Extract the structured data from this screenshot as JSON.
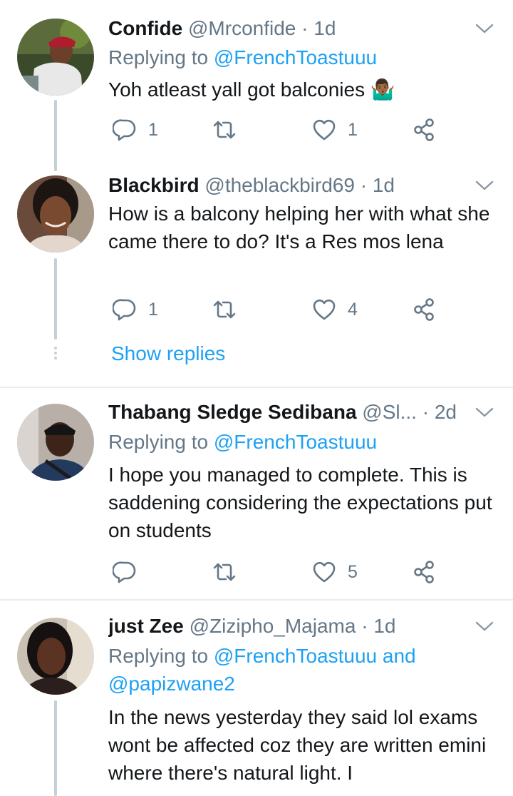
{
  "tweets": [
    {
      "name": "Confide",
      "handle": "@Mrconfide",
      "dot": "·",
      "time": "1d",
      "replying_prefix": "Replying to",
      "replying_to": "@FrenchToastuuu",
      "text": "Yoh atleast yall got balconies 🤷🏾‍♂️",
      "reply_count": "1",
      "retweet_count": "",
      "like_count": "1"
    },
    {
      "name": "Blackbird",
      "handle": "@theblackbird69",
      "dot": "·",
      "time": "1d",
      "text": "How is a balcony helping her with what she came there to do? It's a Res mos lena",
      "reply_count": "1",
      "retweet_count": "",
      "like_count": "4",
      "show_replies": "Show replies"
    },
    {
      "name": "Thabang Sledge Sedibana",
      "handle": "@Sl...",
      "dot": "·",
      "time": "2d",
      "replying_prefix": "Replying to",
      "replying_to": "@FrenchToastuuu",
      "text": "I hope you managed to complete. This is saddening considering the expectations put on students",
      "reply_count": "",
      "retweet_count": "",
      "like_count": "5"
    },
    {
      "name": "just Zee",
      "handle": "@Zizipho_Majama",
      "dot": "·",
      "time": "1d",
      "replying_prefix": "Replying to",
      "replying_to": "@FrenchToastuuu",
      "replying_and": "and",
      "replying_to_2": "@papizwane2",
      "text": "In the news yesterday they said lol exams wont be affected coz they are written emini where there's natural light. I"
    }
  ],
  "icons": {
    "reply": "reply-icon",
    "retweet": "retweet-icon",
    "like": "heart-icon",
    "share": "share-icon",
    "menu": "chevron-down-icon"
  },
  "colors": {
    "accent": "#1da1f2",
    "secondary_text": "#657786",
    "thread_line": "#c4cfd6",
    "divider": "#e6ecf0"
  }
}
